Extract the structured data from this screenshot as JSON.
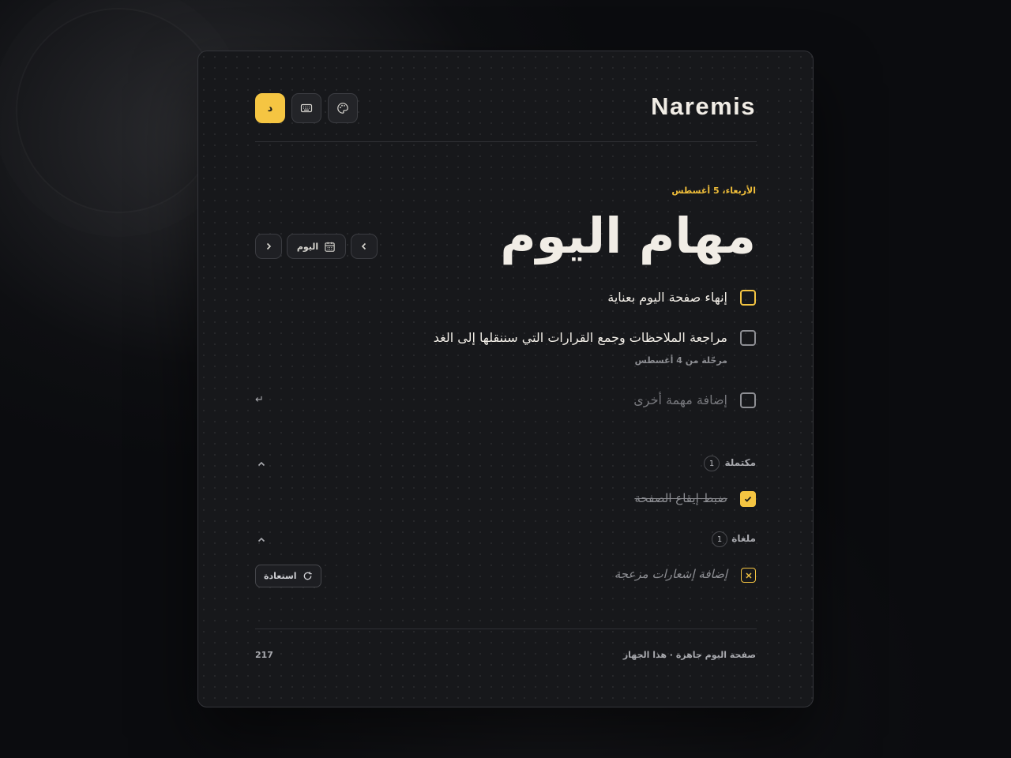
{
  "header": {
    "brand": "Naremis",
    "lang_button": "د"
  },
  "day": {
    "date_label": "الأربعاء، 5 أغسطس",
    "title": "مهام اليوم",
    "today_button": "اليوم"
  },
  "tasks": [
    {
      "text": "إنهاء صفحة اليوم بعناية",
      "status": "active"
    },
    {
      "text": "مراجعة الملاحظات وجمع القرارات التي سننقلها إلى الغد",
      "note": "مرحّلة من 4 أغسطس"
    }
  ],
  "new_task": {
    "placeholder": "إضافة مهمة أخرى",
    "enter_hint": "↵"
  },
  "completed": {
    "label": "مكتملة",
    "count": "1",
    "items": [
      {
        "text": "ضبط إيقاع الصفحة"
      }
    ]
  },
  "cancelled": {
    "label": "ملغاة",
    "count": "1",
    "items": [
      {
        "text": "إضافة إشعارات مزعجة",
        "restore_label": "استعادة"
      }
    ]
  },
  "footer": {
    "status": "صفحة اليوم جاهزة · هذا الجهاز",
    "number": "217"
  },
  "colors": {
    "accent": "#f5c542",
    "background": "#17181b",
    "text": "#f1ede6"
  },
  "icons": [
    "palette-icon",
    "keyboard-icon",
    "calendar-icon",
    "chevron-left-icon",
    "chevron-right-icon",
    "check-icon",
    "x-icon",
    "refresh-icon",
    "chevron-up-icon"
  ]
}
